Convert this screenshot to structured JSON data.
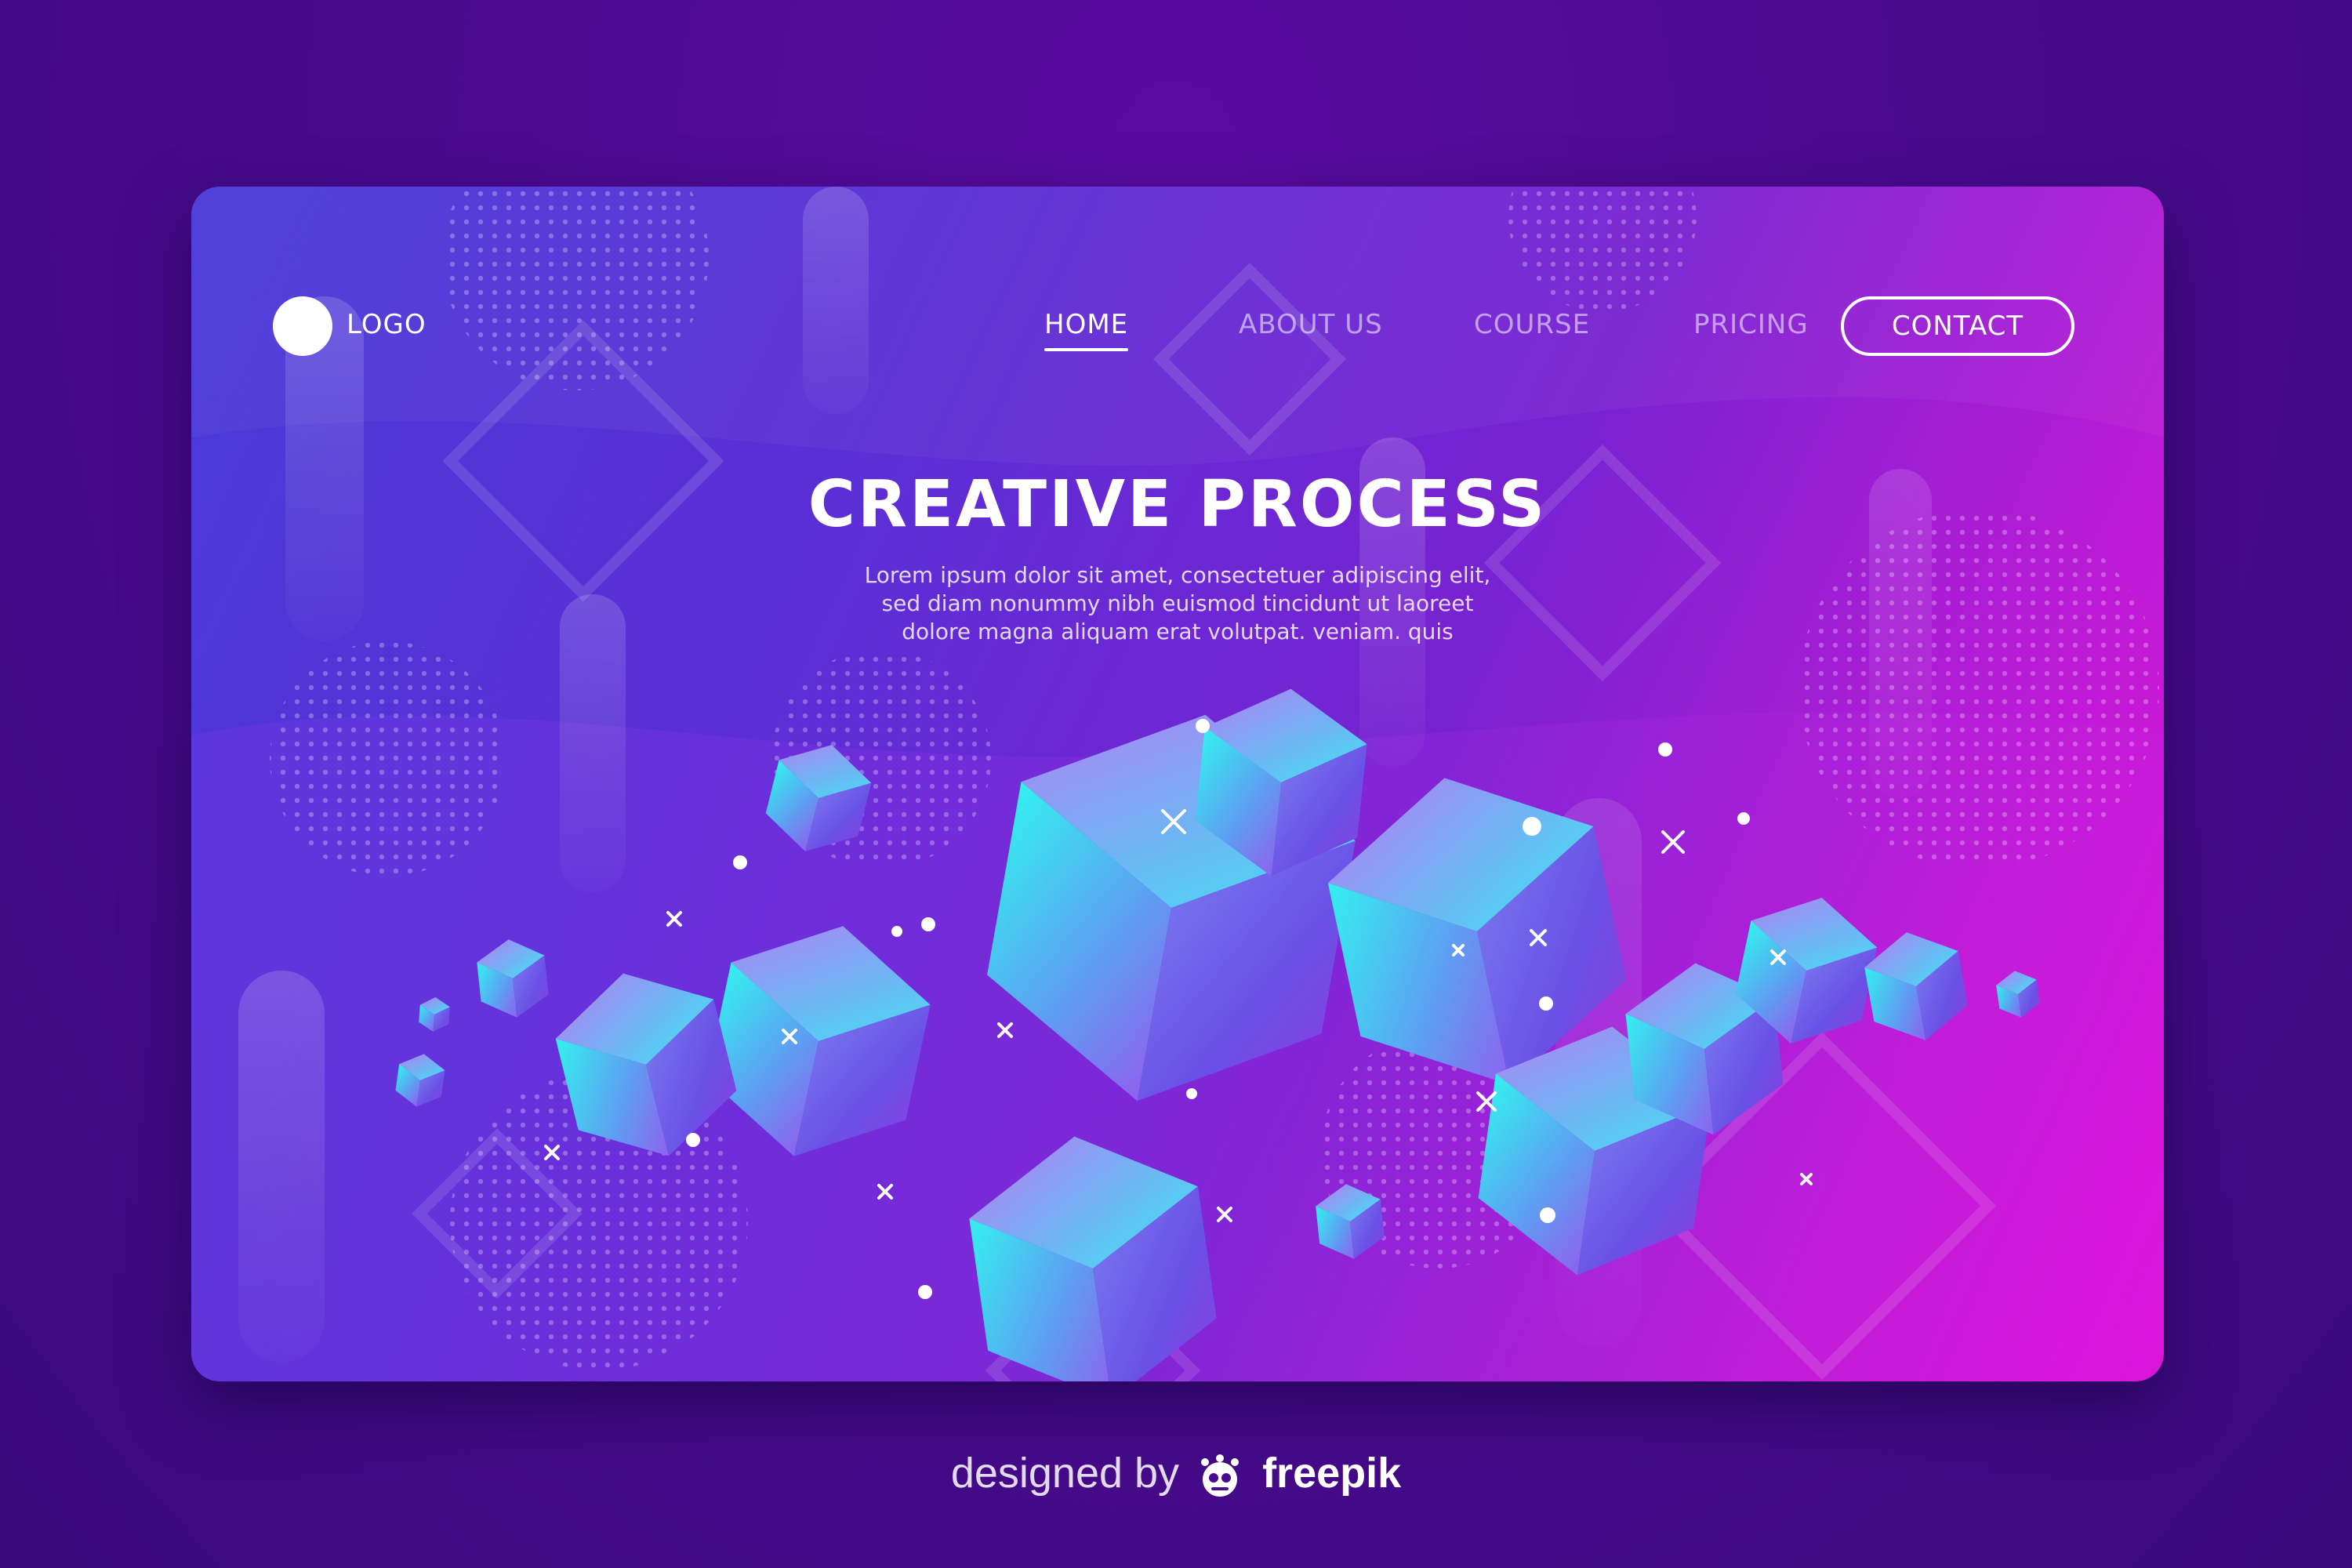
{
  "nav": {
    "logo_label": "LOGO",
    "links": [
      {
        "label": "HOME",
        "active": true
      },
      {
        "label": "ABOUT US",
        "active": false
      },
      {
        "label": "COURSE",
        "active": false
      },
      {
        "label": "PRICING",
        "active": false
      }
    ],
    "contact_label": "CONTACT"
  },
  "hero": {
    "title": "CREATIVE PROCESS",
    "body_lines": [
      "Lorem ipsum dolor sit amet, consectetuer adipiscing elit,",
      "sed diam nonummy nibh euismod tincidunt ut laoreet",
      "dolore magna aliquam erat volutpat. veniam. quis"
    ]
  },
  "illustration": {
    "name": "isometric-cubes-illustration"
  },
  "credit": {
    "prefix": "designed by",
    "brand": "freepik"
  },
  "colors": {
    "page_background": "#4a0a90",
    "card_gradient_start": "#4a3ad8",
    "card_gradient_end": "#e010d8",
    "cube_cyan": "#2ef0f0",
    "cube_violet": "#8a5cf0",
    "text": "#ffffff"
  }
}
